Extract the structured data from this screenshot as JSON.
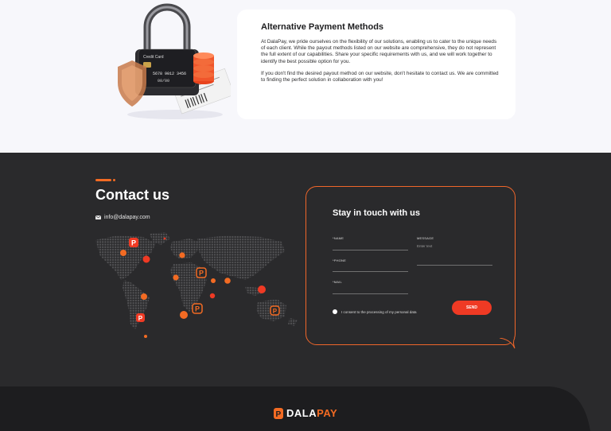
{
  "payment": {
    "title": "Alternative Payment Methods",
    "paragraph1": "At DalaPay, we pride ourselves on the flexibility of our solutions, enabling us to cater to the unique needs of each client. While the payout methods listed on our website are comprehensive, they do not represent the full extent of our capabilities. Share your specific requirements with us, and we will work together to identify the best possible option for you.",
    "paragraph2": "If you don't find the desired payout method on our website, don't hesitate to contact us. We are committed to finding the perfect solution in collaboration with you!",
    "illustration": {
      "card_label": "Credit Card",
      "card_number": "5678 9012 3456",
      "card_expiry": "00/00"
    }
  },
  "contact": {
    "title": "Contact us",
    "email": "info@dalapay.com",
    "icon": "mail-icon"
  },
  "form": {
    "title": "Stay in touch with us",
    "name_label": "*NAME",
    "message_label": "MESSAGE",
    "message_placeholder": "Enter text",
    "phone_label": "*PHONE",
    "mail_label": "*MAIL",
    "consent_text": "I consent to the processing of my personal data",
    "send_label": "SEND"
  },
  "footer": {
    "brand_part1": "DALA",
    "brand_part2": "PAY"
  },
  "colors": {
    "accent": "#f36b23",
    "send_button": "#ef3a24",
    "dark_bg": "#2a2a2c",
    "light_bg": "#f7f7fb"
  }
}
